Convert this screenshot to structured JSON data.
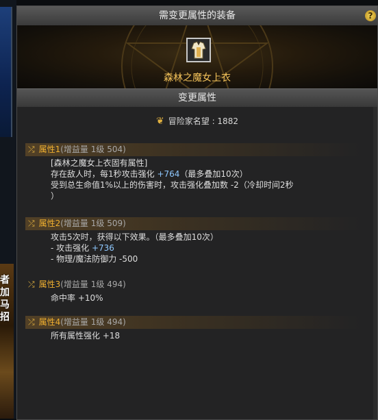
{
  "window": {
    "title": "需变更属性的装备",
    "help_label": "?"
  },
  "item": {
    "name": "森林之魔女上衣",
    "icon": "robe-icon"
  },
  "section": {
    "title": "变更属性"
  },
  "reputation": {
    "icon": "reputation-icon",
    "label": "冒险家名望",
    "value": "1882",
    "text": "冒险家名望 : 1882"
  },
  "side_text": [
    "者",
    "加",
    "马",
    "招"
  ],
  "attributes": [
    {
      "title": "属性1",
      "meta": "(增益量 1级 504)",
      "lines": [
        {
          "text": "[森林之魔女上衣固有属性]"
        },
        {
          "pre": "存在敌人时，每1秒攻击强化 ",
          "highlight": "+764",
          "post": "（最多叠加10次）"
        },
        {
          "text": "受到总生命值1%以上的伤害时，攻击强化叠加数 -2（冷却时间2秒"
        },
        {
          "text": "）"
        }
      ]
    },
    {
      "title": "属性2",
      "meta": "(增益量 1级 509)",
      "lines": [
        {
          "text": "攻击5次时，获得以下效果。（最多叠加10次）"
        },
        {
          "pre": "- 攻击强化 ",
          "highlight": "+736",
          "post": ""
        },
        {
          "text": "- 物理/魔法防御力 -500"
        }
      ]
    },
    {
      "title": "属性3",
      "meta": "(增益量 1级 494)",
      "lines": [
        {
          "text": "命中率 +10%"
        }
      ]
    },
    {
      "title": "属性4",
      "meta": "(增益量 1级 494)",
      "lines": [
        {
          "text": "所有属性强化 +18"
        }
      ]
    }
  ]
}
